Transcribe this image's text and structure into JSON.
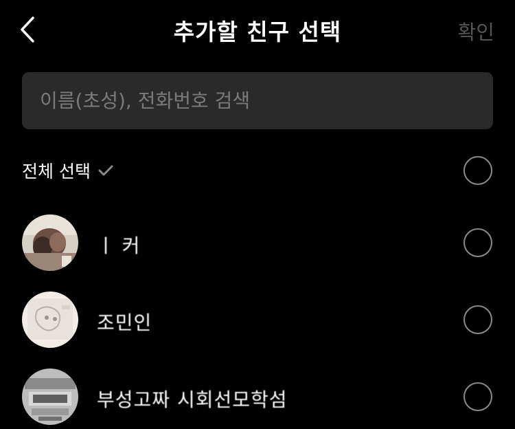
{
  "header": {
    "title": "추가할 친구 선택",
    "confirm_label": "확인",
    "back_icon": "chevron-left-icon"
  },
  "search": {
    "placeholder": "이름(초성), 전화번호 검색",
    "value": ""
  },
  "select_all": {
    "label": "전체 선택",
    "icon": "check-icon",
    "selected": false
  },
  "friends": [
    {
      "name": "ㅣ 커",
      "selected": false
    },
    {
      "name": "조민인",
      "selected": false
    },
    {
      "name": "부성고짜 시회선모학섬",
      "selected": false
    }
  ],
  "colors": {
    "background": "#000000",
    "search_bg": "#2a2a2a",
    "placeholder": "#7a7a7a",
    "confirm_disabled": "#555555",
    "radio_border": "#8a8a8a"
  }
}
